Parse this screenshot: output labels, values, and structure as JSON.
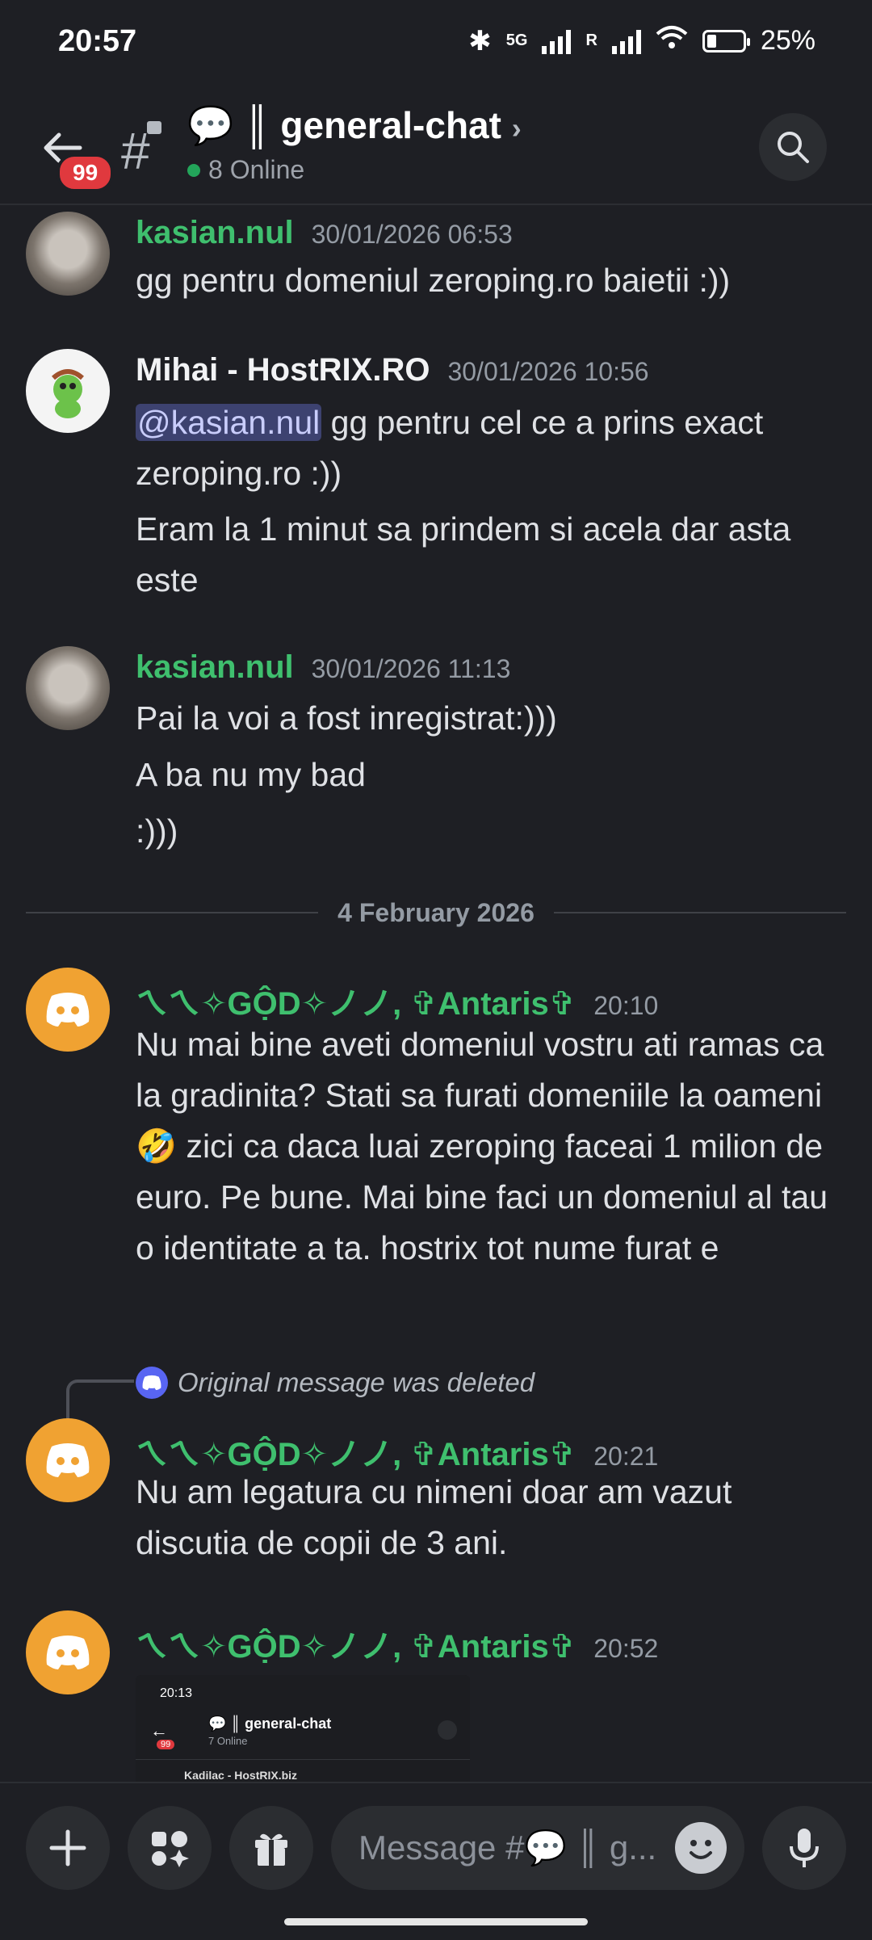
{
  "status_bar": {
    "time": "20:57",
    "network": "5G",
    "roaming": "R",
    "battery": "25%",
    "battery_level": 0.25
  },
  "header": {
    "unread_badge": "99",
    "channel_name": "💬 ║ general-chat",
    "online": "8 Online"
  },
  "messages": [
    {
      "author": "kasian.nul",
      "timestamp": "30/01/2026 06:53",
      "lines": [
        "gg pentru domeniul zeroping.ro baietii :))"
      ]
    },
    {
      "author": "Mihai - HostRIX.RO",
      "timestamp": "30/01/2026 10:56",
      "mention": "@kasian.nul",
      "line1": " gg pentru cel ce a prins exact zeroping.ro :))",
      "line2": "Eram la 1 minut sa prindem si acela dar asta este"
    },
    {
      "author": "kasian.nul",
      "timestamp": "30/01/2026 11:13",
      "lines": [
        "Pai la voi a fost inregistrat:)))",
        "A ba nu my bad",
        ":)))"
      ]
    },
    {
      "author": "ㄟㄟ✧GỘD✧ノノ, ✞Antaris✞",
      "timestamp": "20:10",
      "text": "Nu mai bine aveti domeniul vostru ati ramas ca la gradinita? Stati sa furati domeniile la oameni 🤣 zici ca daca luai zeroping faceai 1 milion de euro. Pe bune. Mai bine faci un domeniul al tau o identitate a ta. hostrix tot nume furat e"
    },
    {
      "author": "ㄟㄟ✧GỘD✧ノノ, ✞Antaris✞",
      "timestamp": "20:21",
      "reply": "Original message was deleted",
      "text": "Nu am legatura cu nimeni doar am vazut discutia de copii de 3 ani."
    },
    {
      "author": "ㄟㄟ✧GỘD✧ノノ, ✞Antaris✞",
      "timestamp": "20:52"
    }
  ],
  "date_divider": "4 February 2026",
  "screenshot_thumb": {
    "time": "20:13",
    "title": "💬 ║ general-chat",
    "online": "7 Online",
    "badge": "99",
    "preview": "Kadilac - HostRIX.biz"
  },
  "composer": {
    "placeholder": "Message #💬 ║ g..."
  },
  "icons": [
    "back-arrow-icon",
    "hash-lock-icon",
    "search-icon",
    "plus-icon",
    "apps-icon",
    "gift-icon",
    "emoji-icon",
    "microphone-icon"
  ]
}
